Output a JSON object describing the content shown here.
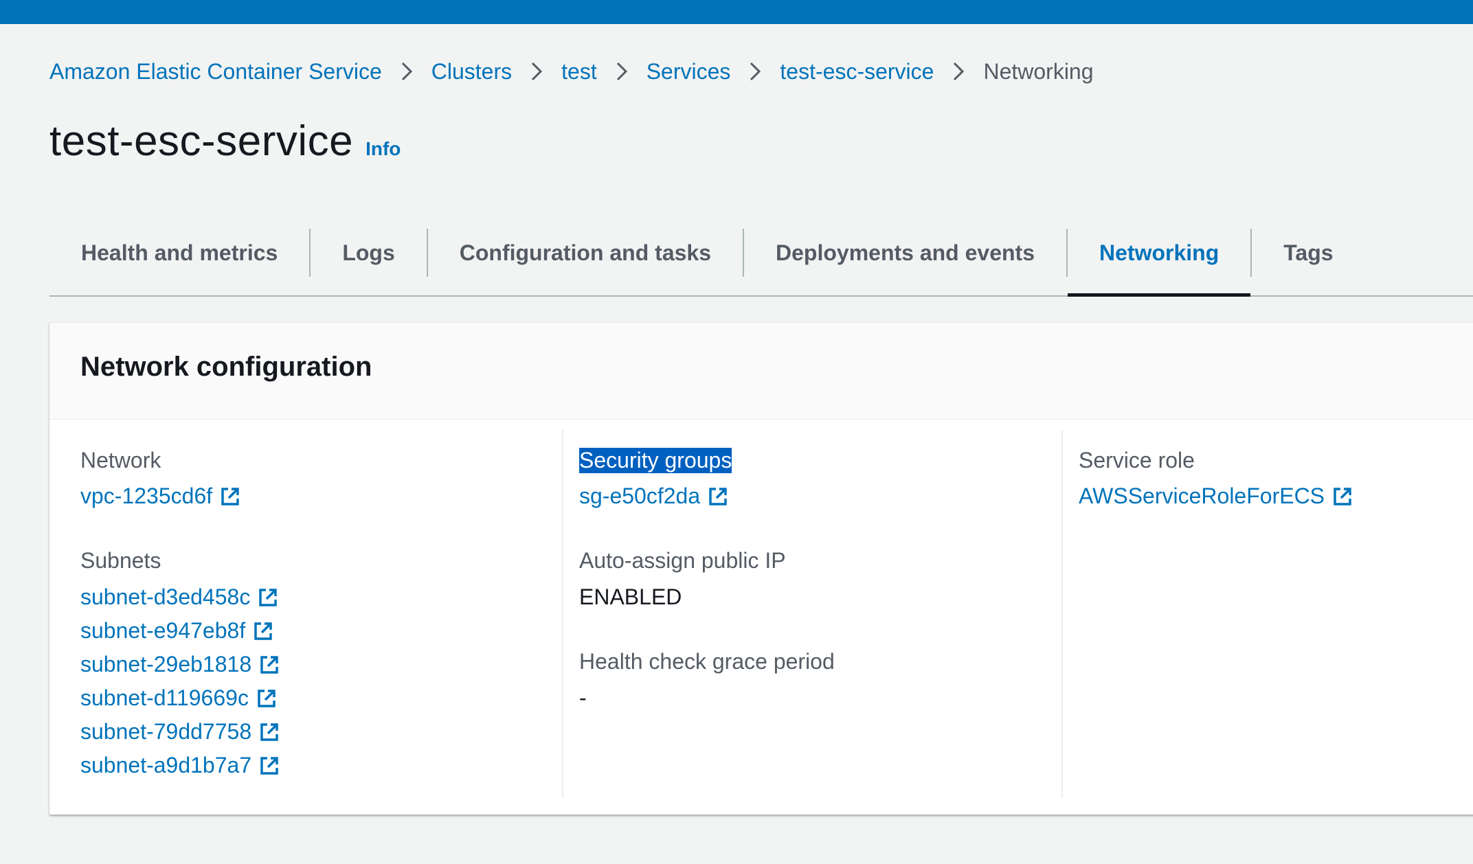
{
  "breadcrumb": {
    "items": [
      "Amazon Elastic Container Service",
      "Clusters",
      "test",
      "Services",
      "test-esc-service"
    ],
    "current": "Networking"
  },
  "header": {
    "title": "test-esc-service",
    "info_label": "Info"
  },
  "tabs": [
    {
      "label": "Health and metrics",
      "active": false
    },
    {
      "label": "Logs",
      "active": false
    },
    {
      "label": "Configuration and tasks",
      "active": false
    },
    {
      "label": "Deployments and events",
      "active": false
    },
    {
      "label": "Networking",
      "active": true
    },
    {
      "label": "Tags",
      "active": false
    }
  ],
  "network_config": {
    "title": "Network configuration",
    "network_label": "Network",
    "network_value": "vpc-1235cd6f",
    "subnets_label": "Subnets",
    "subnets": [
      "subnet-d3ed458c",
      "subnet-e947eb8f",
      "subnet-29eb1818",
      "subnet-d119669c",
      "subnet-79dd7758",
      "subnet-a9d1b7a7"
    ],
    "security_groups_label": "Security groups",
    "security_group_value": "sg-e50cf2da",
    "auto_assign_label": "Auto-assign public IP",
    "auto_assign_value": "ENABLED",
    "grace_period_label": "Health check grace period",
    "grace_period_value": "-",
    "service_role_label": "Service role",
    "service_role_value": "AWSServiceRoleForECS"
  },
  "colors": {
    "top_bar": "#0073bb",
    "link": "#0073bb",
    "active_tab_underline": "#16191f",
    "selection_highlight": "#0060c0"
  },
  "icons": {
    "breadcrumb_separator": "chevron-right-icon",
    "external_link": "external-link-icon"
  }
}
